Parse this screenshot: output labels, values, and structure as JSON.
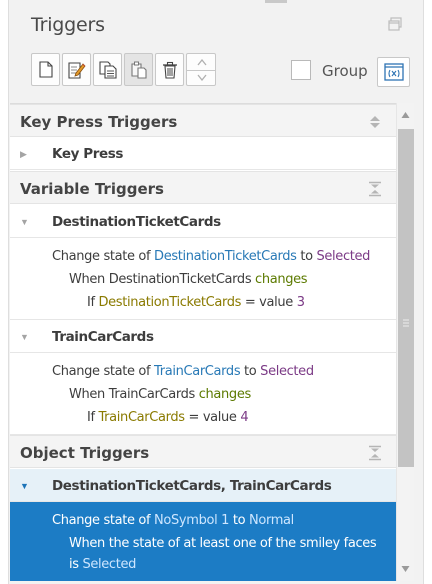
{
  "panel": {
    "title": "Triggers",
    "restore_icon": "restore-window-icon"
  },
  "toolbar": {
    "buttons": [
      {
        "name": "new-trigger-button",
        "icon": "new-document-icon"
      },
      {
        "name": "edit-trigger-button",
        "icon": "edit-document-icon"
      },
      {
        "name": "copy-trigger-button",
        "icon": "copy-icon"
      },
      {
        "name": "paste-trigger-button",
        "icon": "paste-icon"
      },
      {
        "name": "delete-trigger-button",
        "icon": "trash-icon"
      },
      {
        "name": "move-trigger-updown",
        "icon": "up-down-arrows-icon"
      }
    ],
    "group_label": "Group",
    "group_checked": false,
    "variables_icon": "variables-icon"
  },
  "sections": {
    "key_press": {
      "title": "Key Press Triggers",
      "rows": [
        {
          "label": "Key Press"
        }
      ]
    },
    "variable": {
      "title": "Variable Triggers",
      "rows": [
        {
          "label": "DestinationTicketCards",
          "line1": {
            "a": "Change state of ",
            "b": "DestinationTicketCards",
            "c": " to ",
            "d": "Selected"
          },
          "line2": {
            "a": "When DestinationTicketCards ",
            "b": "changes"
          },
          "line3": {
            "a": "If ",
            "b": "DestinationTicketCards",
            "c": " = value ",
            "d": "3"
          }
        },
        {
          "label": "TrainCarCards",
          "line1": {
            "a": "Change state of ",
            "b": "TrainCarCards",
            "c": " to ",
            "d": "Selected"
          },
          "line2": {
            "a": "When TrainCarCards ",
            "b": "changes"
          },
          "line3": {
            "a": "If ",
            "b": "TrainCarCards",
            "c": " = value ",
            "d": "4"
          }
        }
      ]
    },
    "object": {
      "title": "Object Triggers",
      "rows": [
        {
          "label": "DestinationTicketCards, TrainCarCards",
          "line1": {
            "a": "Change state of ",
            "b": "NoSymbol 1",
            "c": " to ",
            "d": "Normal"
          },
          "line2": {
            "a": "When the state of at least one of the smiley faces"
          },
          "line3": {
            "a": "is ",
            "b": "Selected"
          }
        }
      ]
    }
  },
  "colors": {
    "accent_blue": "#1c7cc5",
    "link_blue": "#2879b6",
    "state_purple": "#7b3a86",
    "variable_olive": "#767700",
    "event_green": "#5c7a00"
  }
}
